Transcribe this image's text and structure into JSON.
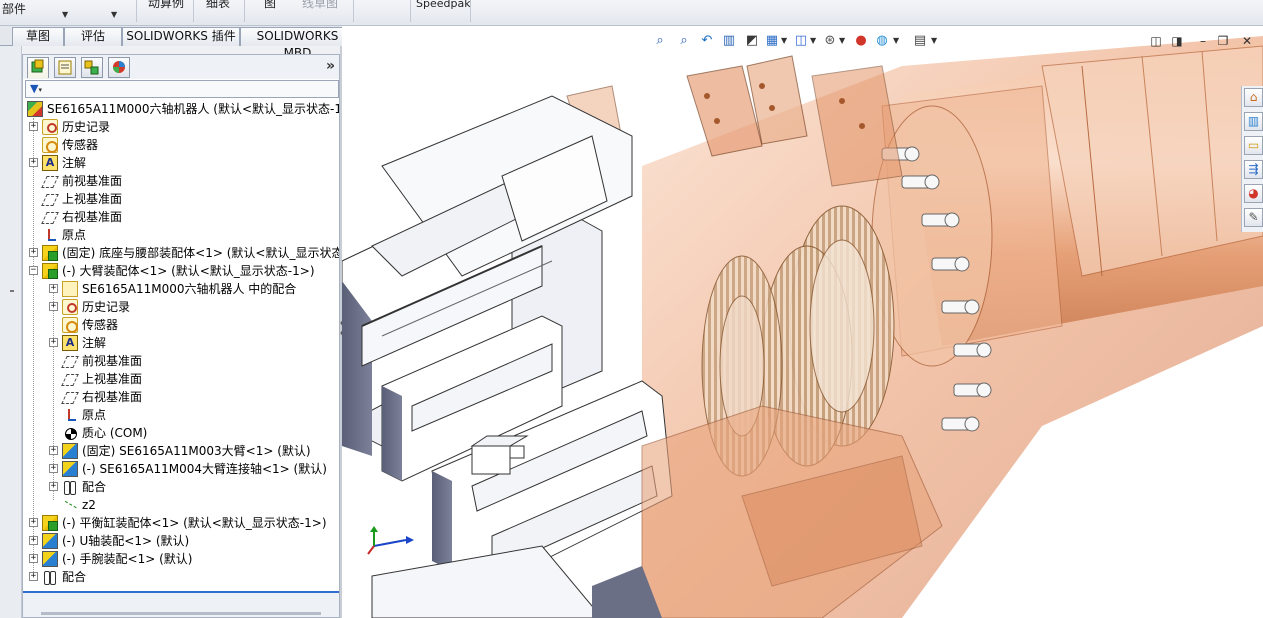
{
  "ribbon": {
    "items": [
      {
        "label": "部件"
      },
      {
        "label": "动算例"
      },
      {
        "label": "细表"
      },
      {
        "label": "图"
      },
      {
        "label": "线草图"
      },
      {
        "label": "Speedpak"
      }
    ]
  },
  "tabs": [
    {
      "label": "草图"
    },
    {
      "label": "评估"
    },
    {
      "label": "SOLIDWORKS 插件"
    },
    {
      "label": "SOLIDWORKS MBD"
    }
  ],
  "feature_manager": {
    "more_glyph": "»",
    "tree": [
      {
        "label": "SE6165A11M000六轴机器人  (默认<默认_显示状态-1",
        "icon": "assembly-root-icon"
      },
      {
        "label": "历史记录",
        "icon": "history-icon"
      },
      {
        "label": "传感器",
        "icon": "sensor-icon"
      },
      {
        "label": "注解",
        "icon": "annotation-icon"
      },
      {
        "label": "前视基准面",
        "icon": "plane-icon"
      },
      {
        "label": "上视基准面",
        "icon": "plane-icon"
      },
      {
        "label": "右视基准面",
        "icon": "plane-icon"
      },
      {
        "label": "原点",
        "icon": "origin-icon"
      },
      {
        "label": "(固定) 底座与腰部装配体<1> (默认<默认_显示状态",
        "icon": "subassembly-icon"
      },
      {
        "label": "(-) 大臂装配体<1> (默认<默认_显示状态-1>)",
        "icon": "subassembly-icon"
      },
      {
        "label": "SE6165A11M000六轴机器人 中的配合",
        "icon": "mate-group-icon"
      },
      {
        "label": "历史记录",
        "icon": "history-icon"
      },
      {
        "label": "传感器",
        "icon": "sensor-icon"
      },
      {
        "label": "注解",
        "icon": "annotation-icon"
      },
      {
        "label": "前视基准面",
        "icon": "plane-icon"
      },
      {
        "label": "上视基准面",
        "icon": "plane-icon"
      },
      {
        "label": "右视基准面",
        "icon": "plane-icon"
      },
      {
        "label": "原点",
        "icon": "origin-icon"
      },
      {
        "label": "质心 (COM)",
        "icon": "center-of-mass-icon"
      },
      {
        "label": "(固定) SE6165A11M003大臂<1> (默认)",
        "icon": "part-icon"
      },
      {
        "label": "(-) SE6165A11M004大臂连接轴<1> (默认)",
        "icon": "part-icon"
      },
      {
        "label": "配合",
        "icon": "mates-icon"
      },
      {
        "label": "z2",
        "icon": "sketch-icon"
      },
      {
        "label": "(-) 平衡缸装配体<1> (默认<默认_显示状态-1>)",
        "icon": "subassembly-icon"
      },
      {
        "label": "(-) U轴装配<1> (默认)",
        "icon": "part-icon"
      },
      {
        "label": "(-) 手腕装配<1> (默认)",
        "icon": "part-icon"
      },
      {
        "label": "配合",
        "icon": "mates-icon"
      }
    ]
  },
  "colors": {
    "accent": "#2f6fd0",
    "copper": "#e8956a",
    "motor_gray": "#6a6f86"
  }
}
